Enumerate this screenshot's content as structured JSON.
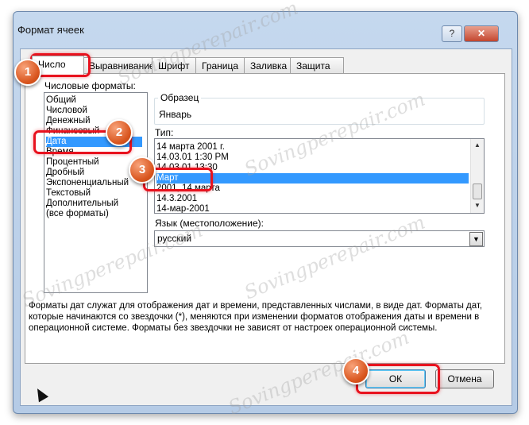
{
  "window": {
    "title": "Формат ячеек",
    "help_button": "?",
    "close_button": "✕"
  },
  "tabs": [
    {
      "label": "Число",
      "active": true
    },
    {
      "label": "Выравнивание",
      "active": false
    },
    {
      "label": "Шрифт",
      "active": false
    },
    {
      "label": "Граница",
      "active": false
    },
    {
      "label": "Заливка",
      "active": false
    },
    {
      "label": "Защита",
      "active": false
    }
  ],
  "number_formats": {
    "label": "Числовые форматы:",
    "items": [
      "Общий",
      "Числовой",
      "Денежный",
      "Финансовый",
      "Дата",
      "Время",
      "Процентный",
      "Дробный",
      "Экспоненциальный",
      "Текстовый",
      "Дополнительный",
      "(все форматы)"
    ],
    "selected": "Дата"
  },
  "sample": {
    "label": "Образец",
    "value": "Январь"
  },
  "type": {
    "label": "Тип:",
    "items": [
      "14 марта 2001 г.",
      "14.03.01 1:30 PM",
      "14.03.01 13:30",
      "Март",
      "2001, 14 марта",
      "14.3.2001",
      "14-мар-2001"
    ],
    "selected": "Март"
  },
  "language": {
    "label": "Язык (местоположение):",
    "value": "русский"
  },
  "description": "Форматы дат служат для отображения дат и времени, представленных числами, в виде дат. Форматы дат, которые начинаются со звездочки (*), меняются при изменении форматов отображения даты и времени в операционной системе. Форматы без звездочки не зависят от настроек операционной системы.",
  "buttons": {
    "ok": "ОК",
    "cancel": "Отмена"
  },
  "annotations": {
    "badge1": "1",
    "badge2": "2",
    "badge3": "3",
    "badge4": "4"
  },
  "watermark": "Sovingperepair.com",
  "colors": {
    "highlight": "#e8121e",
    "selection": "#3399ff",
    "badge": "#d9561f"
  }
}
